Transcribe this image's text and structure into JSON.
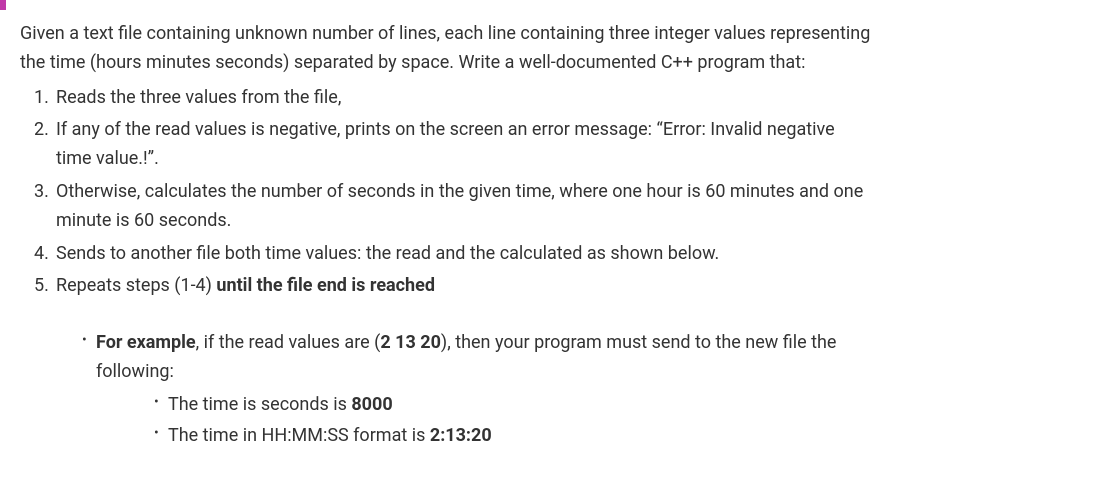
{
  "intro_line1": "Given a text file containing unknown number of lines, each line containing three integer values representing",
  "intro_line2": "the time (hours minutes seconds) separated by space. Write a well-documented C++ program that:",
  "steps": {
    "s1": "Reads the three values from the file,",
    "s2a": "If any of the read values is negative, prints on the screen an error message: “Error: Invalid negative",
    "s2b": "time value.!”.",
    "s3a": "Otherwise, calculates the number of seconds in the given time, where one hour is 60 minutes and one",
    "s3b": "minute is 60 seconds.",
    "s4": "Sends to another file both time values: the read and the calculated as shown below.",
    "s5a": "Repeats steps (1-4) ",
    "s5b": "until the file end is reached"
  },
  "example": {
    "lead_bold": "For example",
    "lead_rest": ", if the read values are (",
    "input_bold": "2 13 20",
    "lead_after": "), then your program must send to the new file the",
    "following": "following:",
    "b1a": "The time is seconds is ",
    "b1b": "8000",
    "b2a": "The time in HH:MM:SS format is ",
    "b2b": "2:13:20"
  }
}
